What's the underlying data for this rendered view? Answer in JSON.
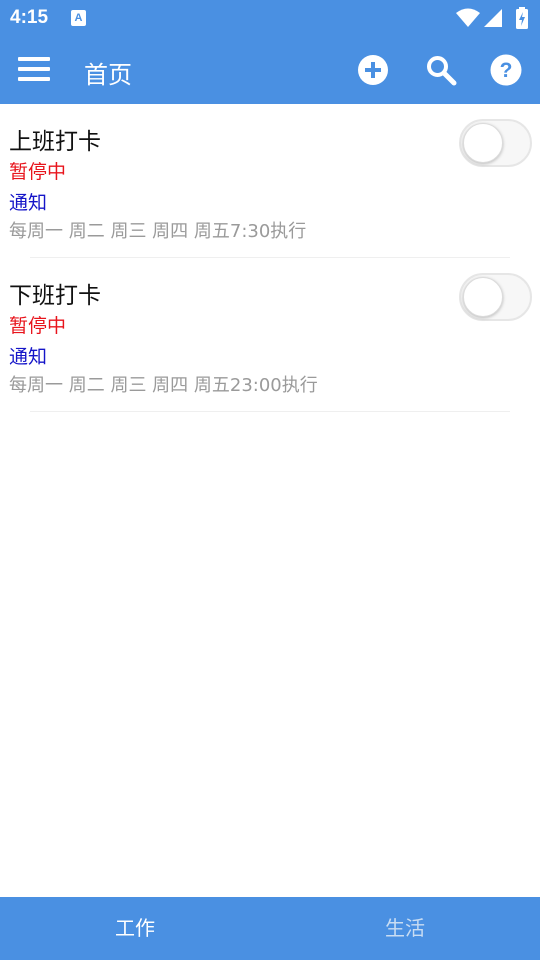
{
  "status_bar": {
    "time": "4:15",
    "app_icon_glyph": "A",
    "icons": [
      "wifi-icon",
      "cell-signal-icon",
      "battery-charging-icon"
    ]
  },
  "app_bar": {
    "title": "首页",
    "menu_icon": "menu-icon",
    "actions": [
      "add-circle-icon",
      "search-icon",
      "help-circle-icon"
    ]
  },
  "tasks": [
    {
      "title": "上班打卡",
      "status": "暂停中",
      "type": "通知",
      "schedule": "每周一 周二 周三 周四 周五7:30执行",
      "enabled": false
    },
    {
      "title": "下班打卡",
      "status": "暂停中",
      "type": "通知",
      "schedule": "每周一 周二 周三 周四 周五23:00执行",
      "enabled": false
    }
  ],
  "bottom_nav": {
    "tabs": [
      {
        "label": "工作",
        "active": true
      },
      {
        "label": "生活",
        "active": false
      }
    ]
  },
  "colors": {
    "primary": "#4a90e2",
    "status_paused": "#e8141c",
    "type_notify": "#1515c8",
    "schedule_text": "#9a9a9a"
  }
}
